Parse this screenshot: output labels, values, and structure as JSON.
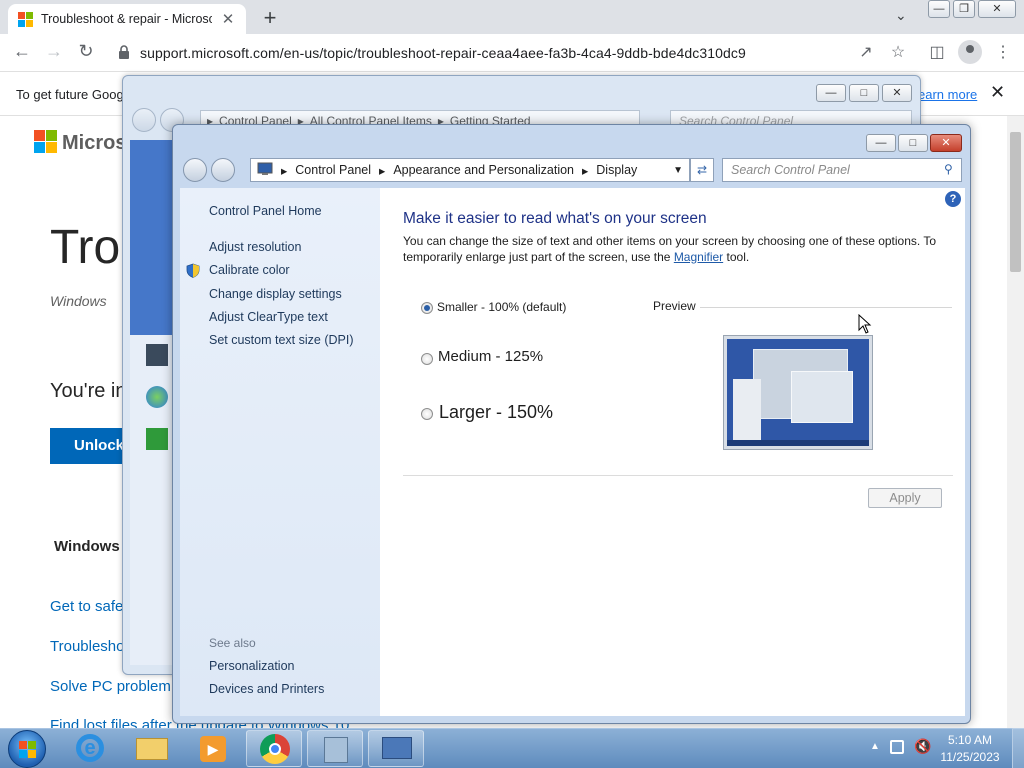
{
  "browser": {
    "tab_title": "Troubleshoot & repair - Microsof",
    "tab_close": "✕",
    "new_tab": "+",
    "url": "support.microsoft.com/en-us/topic/troubleshoot-repair-ceaa4aee-fa3b-4ca4-9ddb-bde4dc310dc9",
    "infobar_text": "To get future Goog",
    "infobar_link": "earn more",
    "infobar_close": "✕"
  },
  "page": {
    "brand": "Microso",
    "heading": "Trou",
    "subheading": "Windows",
    "youre": "You're in",
    "unlock_button": "Unlock",
    "section": "Windows",
    "links": [
      "Get to safe",
      "Troublesho",
      "Solve PC problem",
      "Find lost files after the update to Windows 10"
    ]
  },
  "window_back": {
    "address": [
      "Control Panel",
      "All Control Panel Items",
      "Getting Started"
    ],
    "search_placeholder": "Search Control Panel"
  },
  "window_front": {
    "address": [
      "Control Panel",
      "Appearance and Personalization",
      "Display"
    ],
    "search_placeholder": "Search Control Panel",
    "nav": {
      "home": "Control Panel Home",
      "items": [
        "Adjust resolution",
        "Calibrate color",
        "Change display settings",
        "Adjust ClearType text",
        "Set custom text size (DPI)"
      ],
      "see_also": "See also",
      "see_also_items": [
        "Personalization",
        "Devices and Printers"
      ]
    },
    "content": {
      "title": "Make it easier to read what's on your screen",
      "desc_before": "You can change the size of text and other items on your screen by choosing one of these options. To temporarily enlarge just part of the screen, use the ",
      "desc_link": "Magnifier",
      "desc_after": " tool.",
      "options": [
        "Smaller - 100% (default)",
        "Medium - 125%",
        "Larger - 150%"
      ],
      "selected_option": "Smaller - 100% (default)",
      "preview_label": "Preview",
      "apply_button": "Apply",
      "help": "?"
    }
  },
  "taskbar": {
    "time": "5:10 AM",
    "date": "11/25/2023"
  },
  "colors": {
    "ms_red": "#f25022",
    "ms_green": "#7fba00",
    "ms_blue": "#00a4ef",
    "ms_yellow": "#ffb900",
    "link_blue": "#0067b8"
  }
}
